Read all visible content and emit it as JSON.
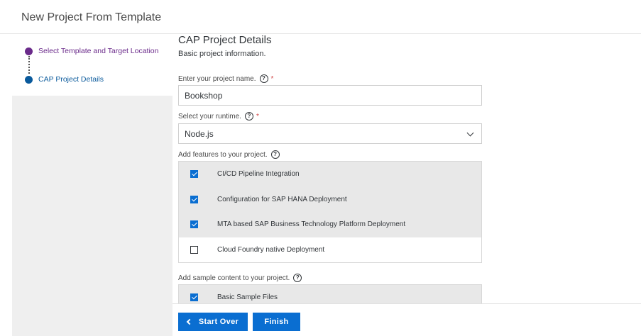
{
  "window": {
    "title": "New Project From Template"
  },
  "steps": [
    {
      "label": "Select Template and Target Location",
      "color": "#6a2a8a"
    },
    {
      "label": "CAP Project Details",
      "color": "#0a5a9c"
    }
  ],
  "section": {
    "title": "CAP Project Details",
    "subtitle": "Basic project information."
  },
  "project_name": {
    "label": "Enter your project name.",
    "value": "Bookshop",
    "required_mark": "*"
  },
  "runtime": {
    "label": "Select your runtime.",
    "value": "Node.js",
    "required_mark": "*"
  },
  "features": {
    "label": "Add features to your project.",
    "items": [
      {
        "label": "CI/CD Pipeline Integration",
        "checked": true
      },
      {
        "label": "Configuration for SAP HANA Deployment",
        "checked": true
      },
      {
        "label": "MTA based SAP Business Technology Platform Deployment",
        "checked": true
      },
      {
        "label": "Cloud Foundry native Deployment",
        "checked": false
      }
    ]
  },
  "sample_content": {
    "label": "Add sample content to your project.",
    "items": [
      {
        "label": "Basic Sample Files",
        "checked": true
      }
    ]
  },
  "footer": {
    "start_over_label": "Start Over",
    "finish_label": "Finish"
  },
  "colors": {
    "accent": "#0a6ed1",
    "required": "#d04343"
  },
  "icons": {
    "help": "?"
  }
}
